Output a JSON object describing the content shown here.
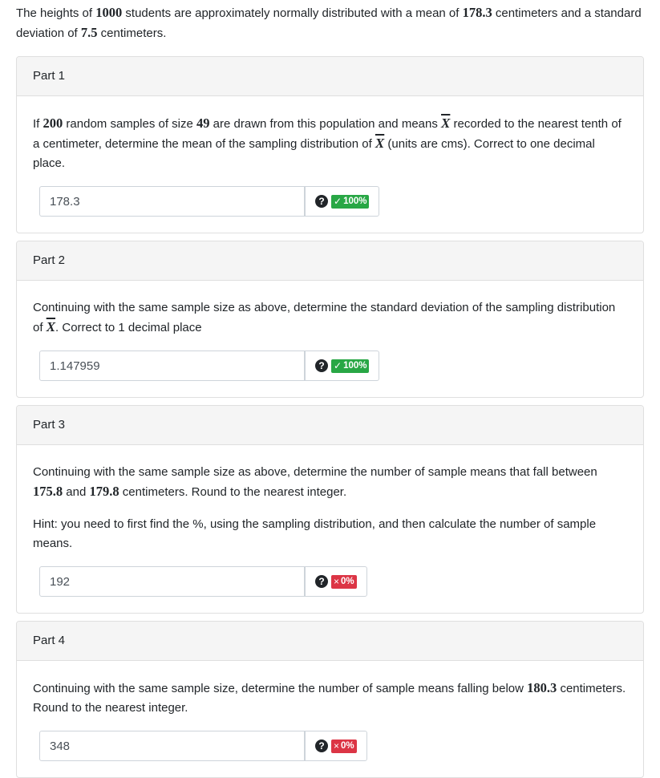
{
  "intro": {
    "t1": "The heights of ",
    "n1": "1000",
    "t2": " students are approximately normally distributed with a mean of ",
    "n2": "178.3",
    "t3": " centimeters and a standard deviation of ",
    "n3": "7.5",
    "t4": " centimeters."
  },
  "xbar_symbol": "X",
  "part1": {
    "title": "Part 1",
    "q": {
      "t1": "If ",
      "n1": "200",
      "t2": " random samples of size ",
      "n2": "49",
      "t3": " are drawn from this population and means ",
      "t4": " recorded to the nearest tenth of a centimeter, determine the mean of the sampling distribution of ",
      "t5": " (units are cms). Correct to one decimal place."
    },
    "answer": "178.3",
    "help_icon": "?",
    "status": {
      "symbol": "✓",
      "text": "100%",
      "color": "#28a745"
    }
  },
  "part2": {
    "title": "Part 2",
    "q": {
      "t1": "Continuing with the same sample size as above, determine the standard deviation of the sampling distribution of ",
      "t2": ". Correct to 1 decimal place"
    },
    "answer": "1.147959",
    "help_icon": "?",
    "status": {
      "symbol": "✓",
      "text": "100%",
      "color": "#28a745"
    }
  },
  "part3": {
    "title": "Part 3",
    "q": {
      "t1": "Continuing with the same sample size as above, determine the number of sample means that fall between ",
      "n1": "175.8",
      "t2": " and ",
      "n2": "179.8",
      "t3": " centimeters. Round to the nearest integer."
    },
    "hint": "Hint: you need to first find the %, using the sampling distribution, and then calculate the number of sample means.",
    "answer": "192",
    "help_icon": "?",
    "status": {
      "symbol": "×",
      "text": "0%",
      "color": "#dc3545"
    }
  },
  "part4": {
    "title": "Part 4",
    "q": {
      "t1": "Continuing with the same sample size, determine the number of sample means falling below ",
      "n1": "180.3",
      "t2": " centimeters. Round to the nearest integer."
    },
    "answer": "348",
    "help_icon": "?",
    "status": {
      "symbol": "×",
      "text": "0%",
      "color": "#dc3545"
    }
  }
}
